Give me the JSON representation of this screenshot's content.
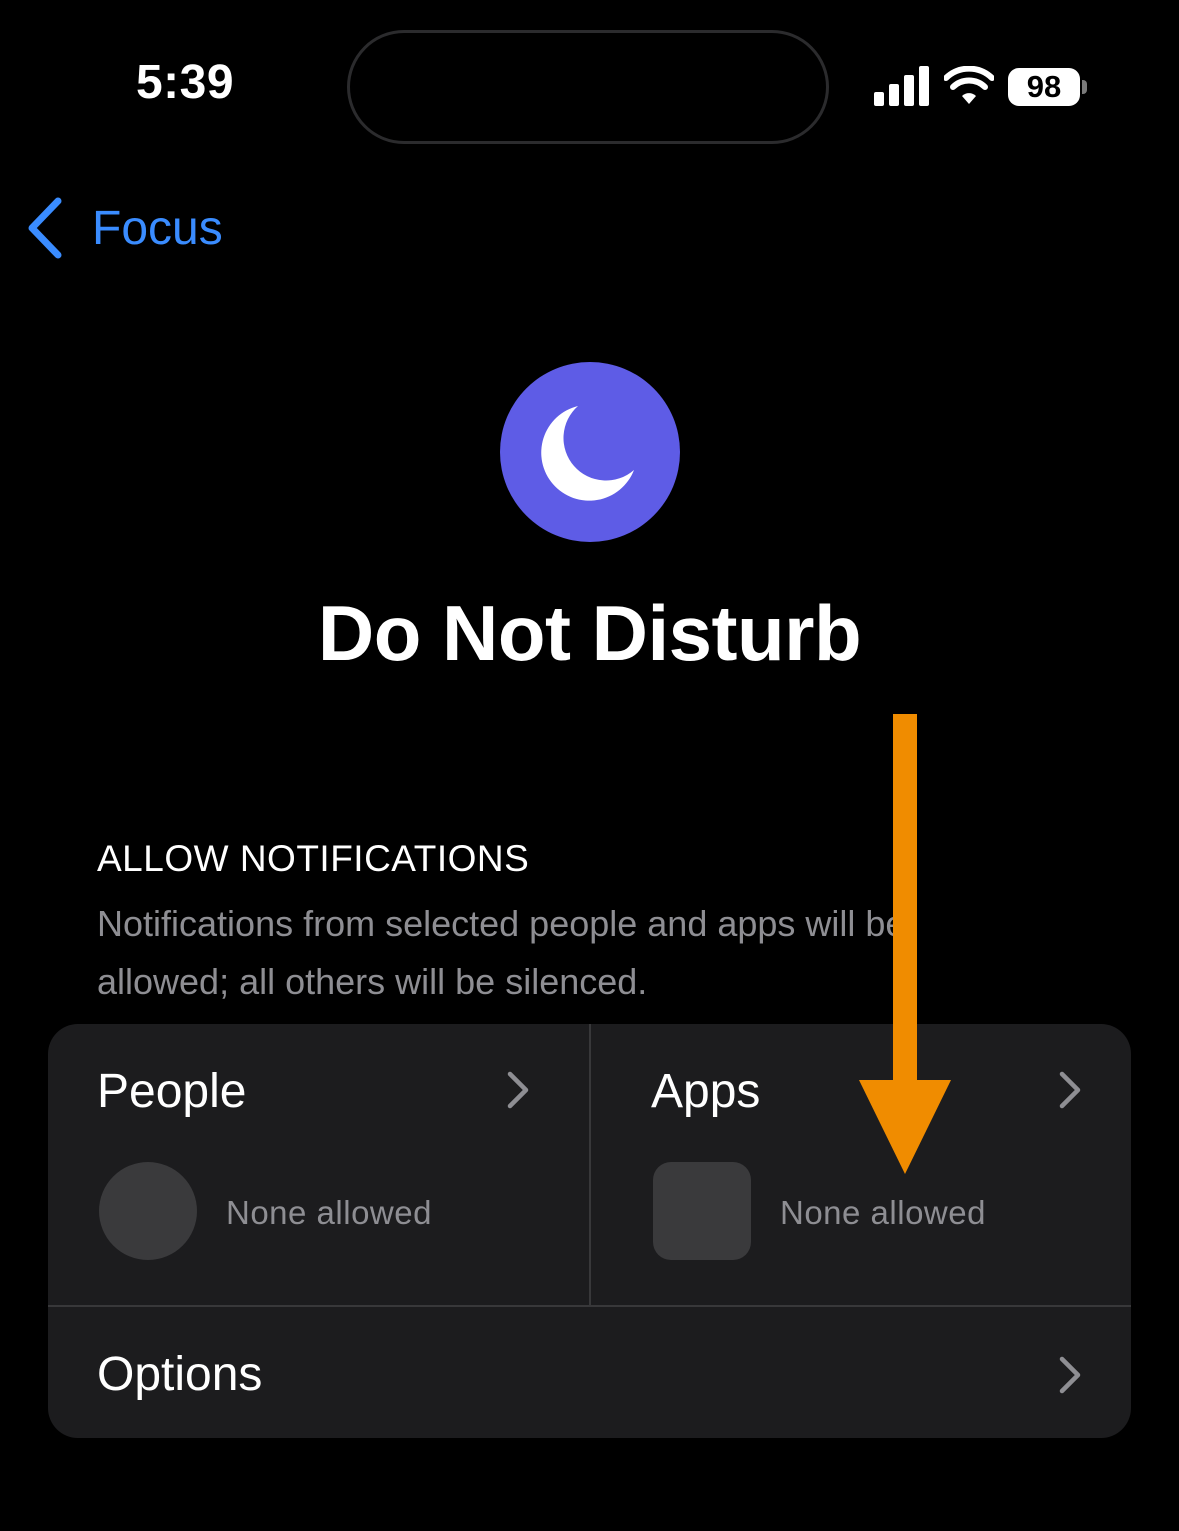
{
  "status_bar": {
    "time": "5:39",
    "battery_level": "98",
    "signal_icon": "cellular-signal-icon",
    "wifi_icon": "wifi-icon"
  },
  "nav": {
    "back_label": "Focus",
    "back_icon": "chevron-left-icon"
  },
  "focus": {
    "icon": "moon-icon",
    "icon_color": "#5e5ce6",
    "title": "Do Not Disturb"
  },
  "allow_notifications": {
    "header": "ALLOW NOTIFICATIONS",
    "description": "Notifications from selected people and apps will be allowed; all others will be silenced.",
    "people": {
      "title": "People",
      "status": "None allowed"
    },
    "apps": {
      "title": "Apps",
      "status": "None allowed"
    },
    "options": {
      "title": "Options"
    }
  },
  "colors": {
    "accent_link": "#3a8cff",
    "card_background": "#1c1c1e",
    "secondary_text": "#8e8e93",
    "annotation_arrow": "#f08c00"
  }
}
